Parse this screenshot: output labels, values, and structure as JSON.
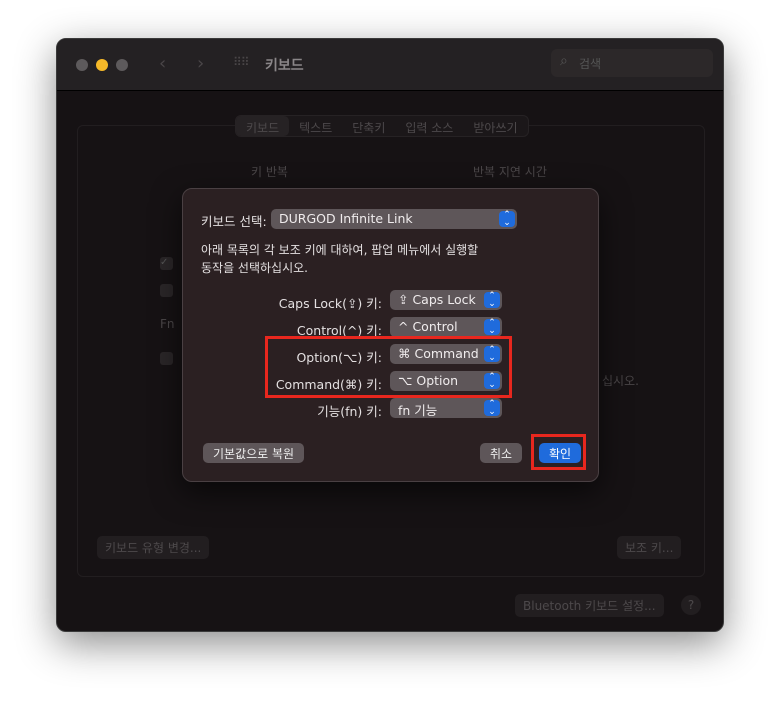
{
  "window": {
    "title": "키보드",
    "search_placeholder": "검색"
  },
  "tabs": [
    {
      "label": "키보드",
      "selected": true
    },
    {
      "label": "텍스트"
    },
    {
      "label": "단축키"
    },
    {
      "label": "입력 소스"
    },
    {
      "label": "받아쓰기"
    }
  ],
  "background": {
    "key_repeat": "키 반복",
    "repeat_delay": "반복 지연 시간",
    "fn_label": "Fn",
    "trailing_text": "십시오.",
    "change_type_button": "키보드 유형 변경...",
    "modifier_button": "보조 키...",
    "bluetooth_button": "Bluetooth 키보드 설정...",
    "help": "?"
  },
  "dialog": {
    "keyboard_label": "키보드 선택:",
    "keyboard_value": "DURGOD Infinite Link",
    "instruction_line1": "아래 목록의 각 보조 키에 대하여, 팝업 메뉴에서 실행할",
    "instruction_line2": "동작을 선택하십시오.",
    "rows": [
      {
        "label": "Caps Lock(⇪) 키:",
        "value": "⇪ Caps Lock"
      },
      {
        "label": "Control(^) 키:",
        "value": "^ Control"
      },
      {
        "label": "Option(⌥) 키:",
        "value": "⌘ Command"
      },
      {
        "label": "Command(⌘) 키:",
        "value": "⌥ Option"
      },
      {
        "label": "기능(fn) 키:",
        "value": "fn 기능"
      }
    ],
    "restore_button": "기본값으로 복원",
    "cancel_button": "취소",
    "ok_button": "확인"
  },
  "colors": {
    "accent": "#1f6bdc",
    "highlight": "#e8271e"
  }
}
